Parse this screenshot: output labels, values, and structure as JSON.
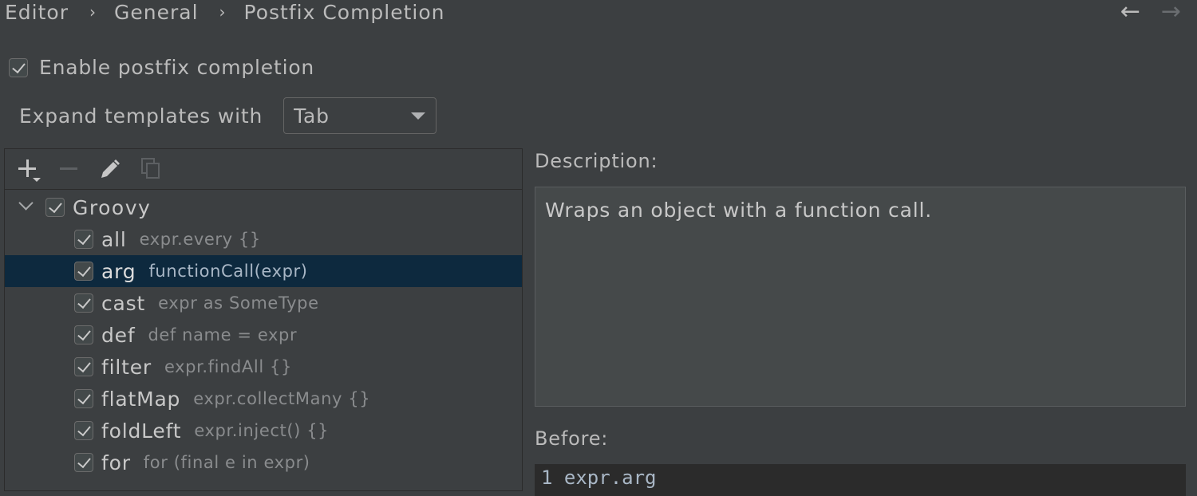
{
  "breadcrumb": [
    "Editor",
    "General",
    "Postfix Completion"
  ],
  "breadcrumb_separator": "›",
  "nav": {
    "back": "←",
    "forward": "→"
  },
  "enable_postfix": {
    "label": "Enable postfix completion",
    "checked": true
  },
  "expand": {
    "label": "Expand templates with",
    "value": "Tab"
  },
  "toolbar": {
    "icons": [
      "add-icon",
      "remove-icon",
      "edit-icon",
      "copy-icon"
    ]
  },
  "tree": {
    "group": {
      "label": "Groovy",
      "checked": true,
      "expanded": true
    },
    "items": [
      {
        "label": "all",
        "desc": "expr.every {}",
        "checked": true
      },
      {
        "label": "arg",
        "desc": "functionCall(expr)",
        "checked": true,
        "selected": true
      },
      {
        "label": "cast",
        "desc": "expr as SomeType",
        "checked": true
      },
      {
        "label": "def",
        "desc": "def name = expr",
        "checked": true
      },
      {
        "label": "filter",
        "desc": "expr.findAll {}",
        "checked": true
      },
      {
        "label": "flatMap",
        "desc": "expr.collectMany {}",
        "checked": true
      },
      {
        "label": "foldLeft",
        "desc": "expr.inject() {}",
        "checked": true
      },
      {
        "label": "for",
        "desc": "for (final e in expr)",
        "checked": true
      }
    ]
  },
  "description": {
    "label": "Description:",
    "text": "Wraps an object with a function call."
  },
  "before": {
    "label": "Before:",
    "code": "1 expr.arg"
  },
  "colors": {
    "background": "#3c3f41",
    "selection": "#0d293e",
    "text": "#bbbbbb"
  }
}
